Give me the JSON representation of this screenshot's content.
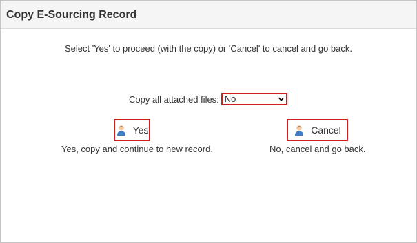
{
  "dialog": {
    "title": "Copy E-Sourcing Record",
    "instruction": "Select 'Yes' to proceed (with the copy) or 'Cancel' to cancel and go back."
  },
  "copy_files": {
    "label": "Copy all attached files:",
    "selected": "No"
  },
  "yes_button": {
    "label": "Yes",
    "icon": "user-icon",
    "caption": "Yes, copy and continue to new record."
  },
  "cancel_button": {
    "label": "Cancel",
    "icon": "user-icon",
    "caption": "No, cancel and go back."
  },
  "colors": {
    "highlight_border": "#d11f1f",
    "title_bar": "#f5f5f5",
    "text": "#333333"
  }
}
